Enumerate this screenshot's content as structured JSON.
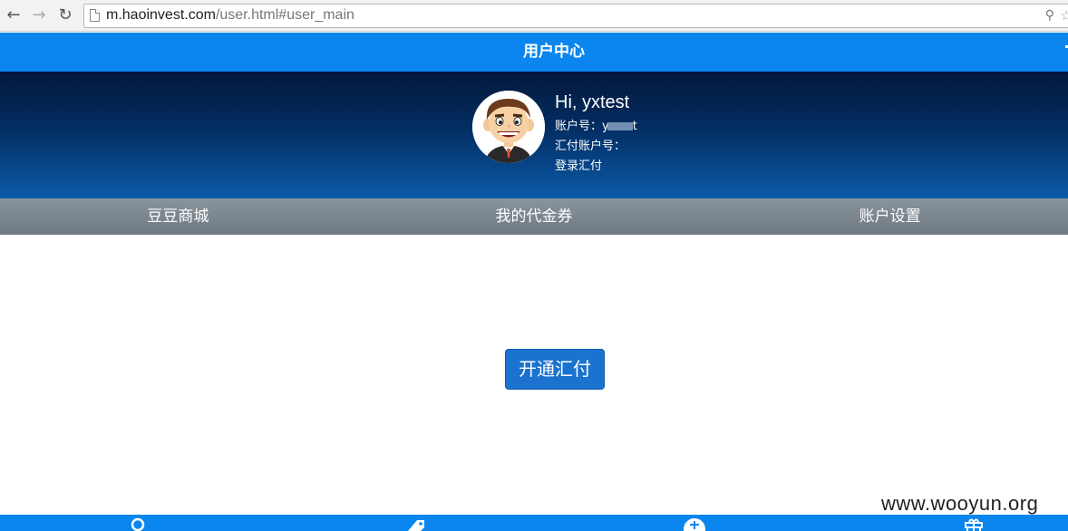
{
  "browser": {
    "url_host": "m.haoinvest.com",
    "url_path": "/user.html#user_main",
    "back_icon": "arrow-left-icon",
    "forward_icon": "arrow-right-icon",
    "reload_icon": "reload-icon"
  },
  "header": {
    "title": "用户中心"
  },
  "profile": {
    "greeting": "Hi, yxtest",
    "account_label": "账户号：",
    "account_visible_start": "y",
    "account_visible_end": "t",
    "huifu_account_label": "汇付账户号：",
    "login_huifu": "登录汇付"
  },
  "tabs": [
    {
      "label": "豆豆商城"
    },
    {
      "label": "我的代金券"
    },
    {
      "label": "账户设置"
    }
  ],
  "main": {
    "open_huifu_button": "开通汇付"
  },
  "bottom_nav": {
    "icons": [
      "user-icon",
      "tag-icon",
      "plus-circle-icon",
      "gift-icon"
    ]
  },
  "watermark": "www.wooyun.org",
  "colors": {
    "header_blue": "#0a86ee",
    "button_blue": "#1b72cf",
    "banner_dark": "#03173a",
    "tab_gray": "#7a848c"
  }
}
